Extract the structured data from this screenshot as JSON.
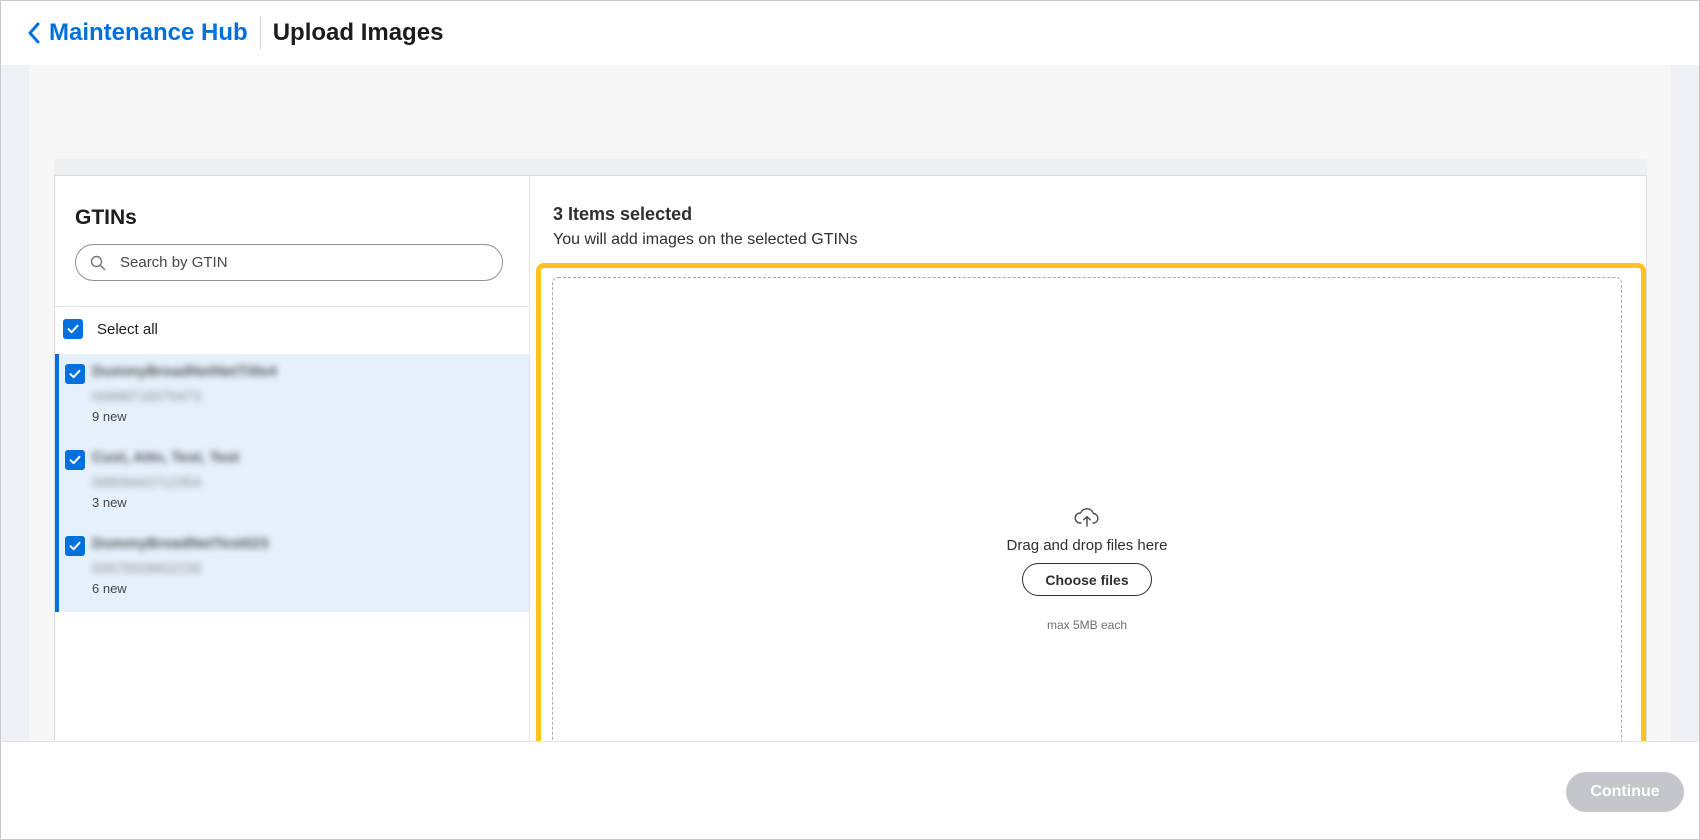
{
  "header": {
    "back_label": "Maintenance Hub",
    "title": "Upload Images"
  },
  "left": {
    "title": "GTINs",
    "search_placeholder": "Search by GTIN",
    "select_all_label": "Select all",
    "items": [
      {
        "name": "DummyBreadNetNetTitle4",
        "code": "00688718075473",
        "count": "9 new"
      },
      {
        "name": "Cust, Attn, Test, Test",
        "code": "06808442712354",
        "count": "3 new"
      },
      {
        "name": "DummyBreadNetTest023",
        "code": "00679509652238",
        "count": "6 new"
      }
    ]
  },
  "right": {
    "selected_title": "3 Items selected",
    "selected_subtitle": "You will add images on the selected GTINs",
    "dropzone_text": "Drag and drop files here",
    "choose_files_label": "Choose files",
    "max_note": "max 5MB each"
  },
  "footer": {
    "continue_label": "Continue"
  },
  "colors": {
    "brand_blue": "#0071dc",
    "highlight": "#ffc220",
    "selected_row_bg": "#e5f0fb",
    "disabled_button": "#c4c6ca"
  },
  "icons": {
    "back": "chevron-left-icon",
    "search": "search-icon",
    "check": "check-icon",
    "upload": "cloud-upload-icon"
  }
}
